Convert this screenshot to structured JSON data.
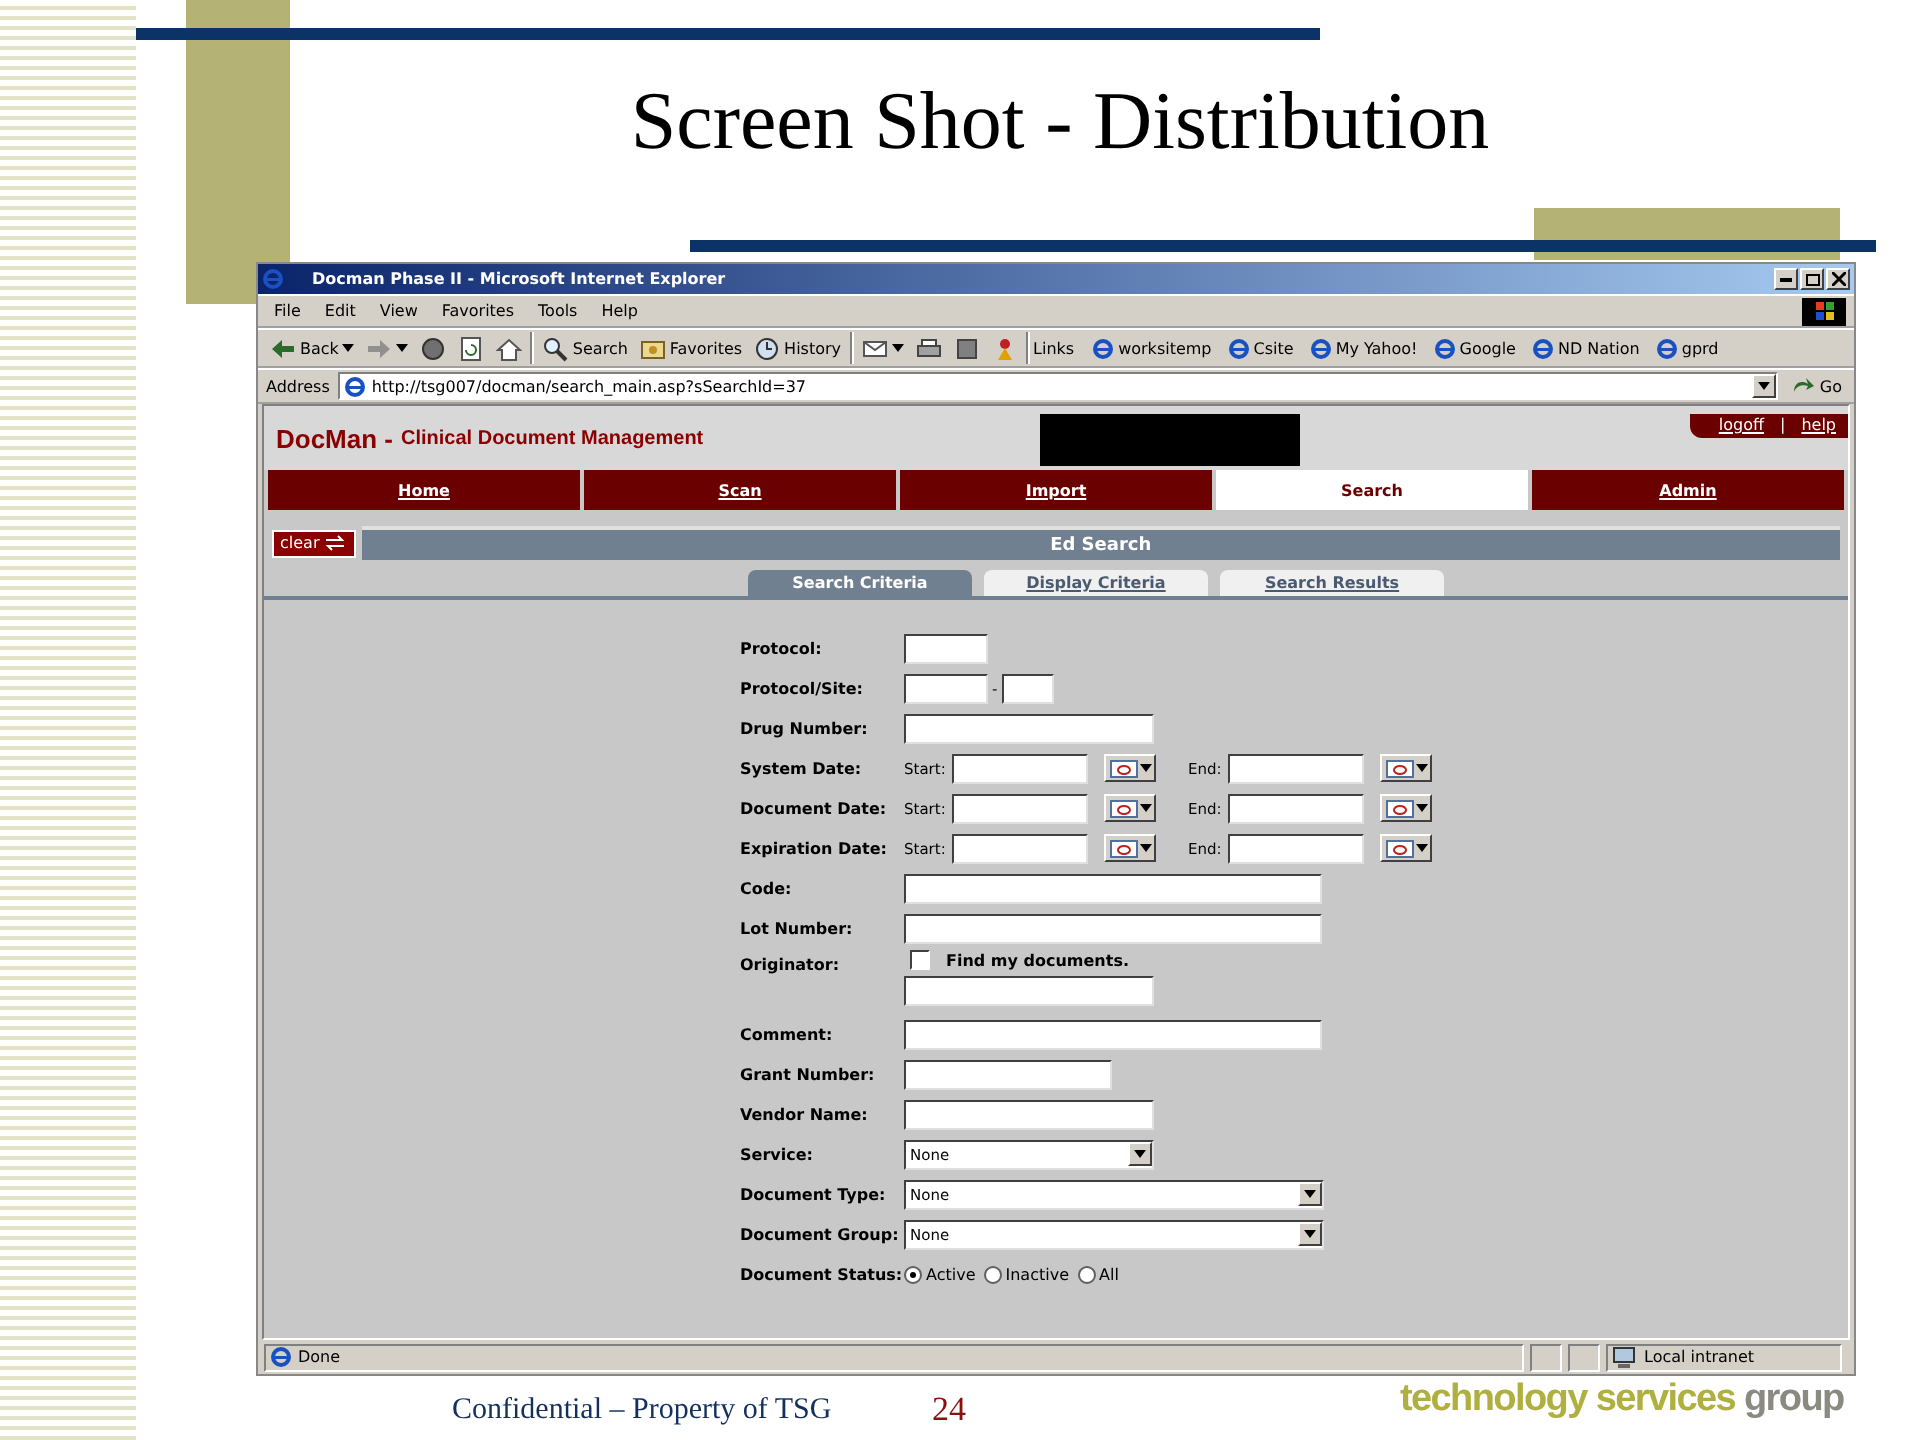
{
  "slide": {
    "title": "Screen Shot - Distribution",
    "footer": "Confidential – Property of TSG",
    "page_number": "24",
    "logo": {
      "first": "technology services",
      "last": "group"
    }
  },
  "browser": {
    "title": "Docman Phase II - Microsoft Internet Explorer",
    "menu": [
      "File",
      "Edit",
      "View",
      "Favorites",
      "Tools",
      "Help"
    ],
    "toolbar": [
      {
        "kind": "back",
        "label": "Back"
      },
      {
        "kind": "forward"
      },
      {
        "kind": "stop"
      },
      {
        "kind": "refresh"
      },
      {
        "kind": "home"
      },
      {
        "kind": "search",
        "label": "Search"
      },
      {
        "kind": "favorites",
        "label": "Favorites"
      },
      {
        "kind": "history",
        "label": "History"
      },
      {
        "kind": "mail"
      },
      {
        "kind": "print"
      },
      {
        "kind": "edit"
      },
      {
        "kind": "messenger"
      }
    ],
    "links_label": "Links",
    "links": [
      "worksitemp",
      "Csite",
      "My Yahoo!",
      "Google",
      "ND Nation",
      "gprd"
    ],
    "address_label": "Address",
    "url": "http://tsg007/docman/search_main.asp?sSearchId=37",
    "go": "Go",
    "status": "Done",
    "zone": "Local intranet"
  },
  "app": {
    "brand": "DocMan -",
    "subtitle": "Clinical Document Management",
    "header_links": [
      "logoff",
      "help"
    ],
    "header_separator": "|",
    "nav": [
      {
        "label": "Home",
        "selected": false
      },
      {
        "label": "Scan",
        "selected": false
      },
      {
        "label": "Import",
        "selected": false
      },
      {
        "label": "Search",
        "selected": true
      },
      {
        "label": "Admin",
        "selected": false
      }
    ],
    "clear": "clear",
    "section": "Ed Search",
    "subtabs": [
      {
        "label": "Search Criteria",
        "selected": true
      },
      {
        "label": "Display Criteria",
        "selected": false
      },
      {
        "label": "Search Results",
        "selected": false
      }
    ],
    "form": [
      {
        "kind": "text",
        "label": "Protocol:"
      },
      {
        "kind": "pair",
        "label": "Protocol/Site:",
        "separator": "-"
      },
      {
        "kind": "text",
        "label": "Drug Number:"
      },
      {
        "kind": "date",
        "label": "System Date:",
        "start": "Start:",
        "end": "End:"
      },
      {
        "kind": "date",
        "label": "Document Date:",
        "start": "Start:",
        "end": "End:"
      },
      {
        "kind": "date",
        "label": "Expiration Date:",
        "start": "Start:",
        "end": "End:"
      },
      {
        "kind": "text",
        "label": "Code:"
      },
      {
        "kind": "text",
        "label": "Lot Number:"
      },
      {
        "kind": "checkbox",
        "label": "Originator:",
        "option": "Find my documents.",
        "checked": false
      },
      {
        "kind": "text",
        "label": "Comment:"
      },
      {
        "kind": "text",
        "label": "Grant Number:"
      },
      {
        "kind": "text",
        "label": "Vendor Name:"
      },
      {
        "kind": "select",
        "label": "Service:",
        "value": "None"
      },
      {
        "kind": "select",
        "label": "Document Type:",
        "value": "None"
      },
      {
        "kind": "select",
        "label": "Document Group:",
        "value": "None"
      },
      {
        "kind": "radio",
        "label": "Document Status:",
        "options": [
          {
            "label": "Active",
            "selected": true
          },
          {
            "label": "Inactive",
            "selected": false
          },
          {
            "label": "All",
            "selected": false
          }
        ]
      }
    ]
  }
}
